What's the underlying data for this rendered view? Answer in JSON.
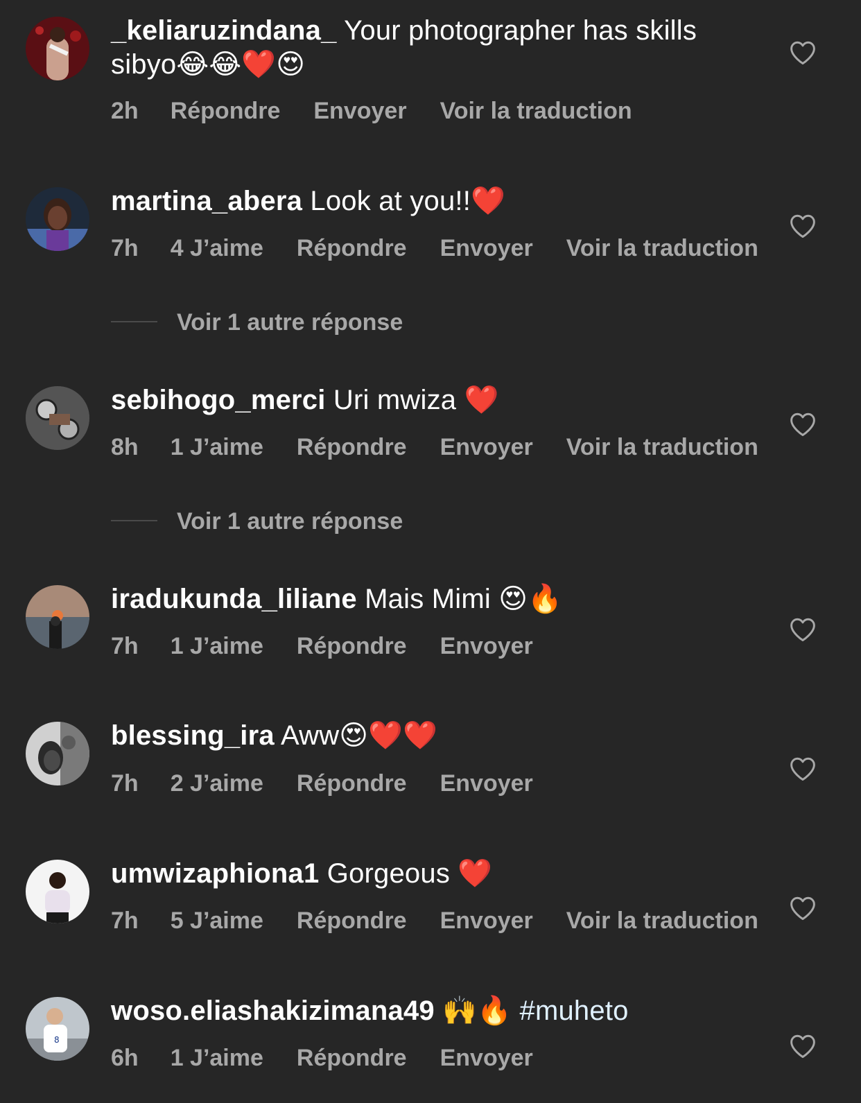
{
  "colors": {
    "background": "#262626",
    "meta_text": "#a8a8a8",
    "primary_text": "#ffffff",
    "hashtag": "#e0f1ff",
    "heart_outline": "#a8a8a8"
  },
  "comments": [
    {
      "username": "_keliaruzindana_",
      "text": "Your photographer has skills sibyo😂😂❤️😍",
      "time": "2h",
      "likes": "",
      "reply": "Répondre",
      "send": "Envoyer",
      "translate": "Voir la traduction"
    },
    {
      "username": "martina_abera",
      "text": "Look at you!!❤️",
      "time": "7h",
      "likes": "4 J’aime",
      "reply": "Répondre",
      "send": "Envoyer",
      "translate": "Voir la traduction",
      "more_replies": "Voir 1 autre réponse"
    },
    {
      "username": "sebihogo_merci",
      "text": "Uri mwiza ❤️",
      "time": "8h",
      "likes": "1 J’aime",
      "reply": "Répondre",
      "send": "Envoyer",
      "translate": "Voir la traduction",
      "more_replies": "Voir 1 autre réponse"
    },
    {
      "username": "iradukunda_liliane",
      "text": "Mais Mimi 😍🔥",
      "time": "7h",
      "likes": "1 J’aime",
      "reply": "Répondre",
      "send": "Envoyer"
    },
    {
      "username": "blessing_ira",
      "text": "Aww😍❤️❤️",
      "time": "7h",
      "likes": "2 J’aime",
      "reply": "Répondre",
      "send": "Envoyer"
    },
    {
      "username": "umwizaphiona1",
      "text": "Gorgeous ❤️",
      "time": "7h",
      "likes": "5 J’aime",
      "reply": "Répondre",
      "send": "Envoyer",
      "translate": "Voir la traduction"
    },
    {
      "username": "woso.eliashakizimana49",
      "text": "🙌🔥",
      "hashtag": "#muheto",
      "time": "6h",
      "likes": "1 J’aime",
      "reply": "Répondre",
      "send": "Envoyer"
    }
  ]
}
